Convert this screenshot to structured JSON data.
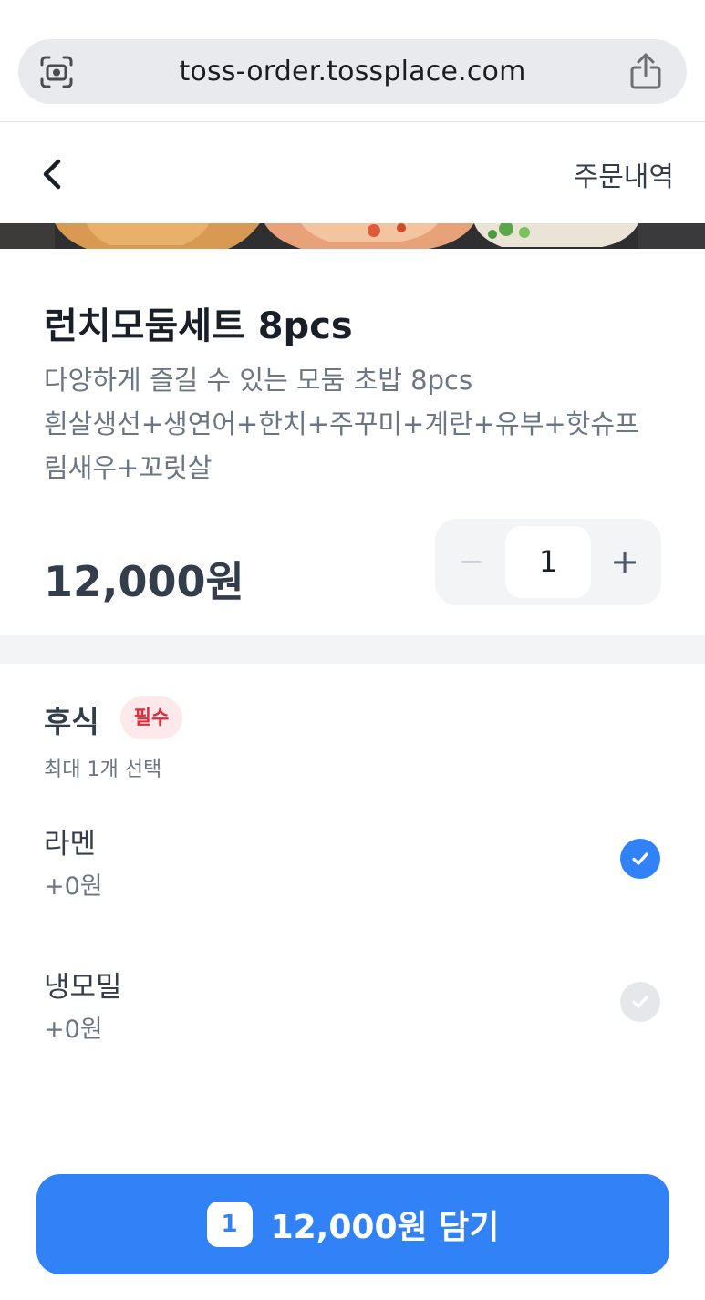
{
  "browser": {
    "url": "toss-order.tossplace.com",
    "left_icon": "screen-capture-icon",
    "right_icon": "share-icon"
  },
  "header": {
    "back_icon": "chevron-left-icon",
    "order_history_label": "주문내역"
  },
  "product": {
    "title": "런치모둠세트 8pcs",
    "description_lines": [
      "다양하게 즐길 수 있는 모둠 초밥 8pcs",
      "흰살생선+생연어+한치+주꾸미+계란+유부+핫슈프",
      "림새우+꼬릿살"
    ],
    "price": "12,000원",
    "quantity": "1",
    "minus_label": "−",
    "plus_label": "+"
  },
  "option_group": {
    "title": "후식",
    "required_badge": "필수",
    "subtitle": "최대 1개 선택",
    "options": [
      {
        "name": "라멘",
        "price": "+0원",
        "selected": true
      },
      {
        "name": "냉모밀",
        "price": "+0원",
        "selected": false
      }
    ]
  },
  "cta": {
    "count": "1",
    "label": "12,000원 담기"
  },
  "colors": {
    "primary": "#3182f6",
    "required_bg": "#fde8ea",
    "required_text": "#e42939",
    "unselected_check": "#e5e8eb"
  }
}
